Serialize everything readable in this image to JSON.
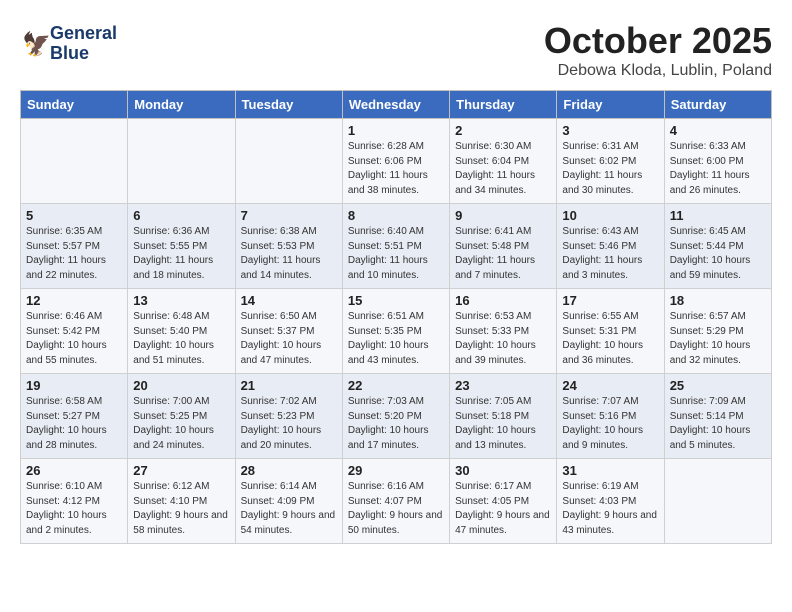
{
  "logo": {
    "line1": "General",
    "line2": "Blue"
  },
  "header": {
    "month_year": "October 2025",
    "location": "Debowa Kloda, Lublin, Poland"
  },
  "weekdays": [
    "Sunday",
    "Monday",
    "Tuesday",
    "Wednesday",
    "Thursday",
    "Friday",
    "Saturday"
  ],
  "weeks": [
    [
      {
        "day": "",
        "sunrise": "",
        "sunset": "",
        "daylight": ""
      },
      {
        "day": "",
        "sunrise": "",
        "sunset": "",
        "daylight": ""
      },
      {
        "day": "",
        "sunrise": "",
        "sunset": "",
        "daylight": ""
      },
      {
        "day": "1",
        "sunrise": "Sunrise: 6:28 AM",
        "sunset": "Sunset: 6:06 PM",
        "daylight": "Daylight: 11 hours and 38 minutes."
      },
      {
        "day": "2",
        "sunrise": "Sunrise: 6:30 AM",
        "sunset": "Sunset: 6:04 PM",
        "daylight": "Daylight: 11 hours and 34 minutes."
      },
      {
        "day": "3",
        "sunrise": "Sunrise: 6:31 AM",
        "sunset": "Sunset: 6:02 PM",
        "daylight": "Daylight: 11 hours and 30 minutes."
      },
      {
        "day": "4",
        "sunrise": "Sunrise: 6:33 AM",
        "sunset": "Sunset: 6:00 PM",
        "daylight": "Daylight: 11 hours and 26 minutes."
      }
    ],
    [
      {
        "day": "5",
        "sunrise": "Sunrise: 6:35 AM",
        "sunset": "Sunset: 5:57 PM",
        "daylight": "Daylight: 11 hours and 22 minutes."
      },
      {
        "day": "6",
        "sunrise": "Sunrise: 6:36 AM",
        "sunset": "Sunset: 5:55 PM",
        "daylight": "Daylight: 11 hours and 18 minutes."
      },
      {
        "day": "7",
        "sunrise": "Sunrise: 6:38 AM",
        "sunset": "Sunset: 5:53 PM",
        "daylight": "Daylight: 11 hours and 14 minutes."
      },
      {
        "day": "8",
        "sunrise": "Sunrise: 6:40 AM",
        "sunset": "Sunset: 5:51 PM",
        "daylight": "Daylight: 11 hours and 10 minutes."
      },
      {
        "day": "9",
        "sunrise": "Sunrise: 6:41 AM",
        "sunset": "Sunset: 5:48 PM",
        "daylight": "Daylight: 11 hours and 7 minutes."
      },
      {
        "day": "10",
        "sunrise": "Sunrise: 6:43 AM",
        "sunset": "Sunset: 5:46 PM",
        "daylight": "Daylight: 11 hours and 3 minutes."
      },
      {
        "day": "11",
        "sunrise": "Sunrise: 6:45 AM",
        "sunset": "Sunset: 5:44 PM",
        "daylight": "Daylight: 10 hours and 59 minutes."
      }
    ],
    [
      {
        "day": "12",
        "sunrise": "Sunrise: 6:46 AM",
        "sunset": "Sunset: 5:42 PM",
        "daylight": "Daylight: 10 hours and 55 minutes."
      },
      {
        "day": "13",
        "sunrise": "Sunrise: 6:48 AM",
        "sunset": "Sunset: 5:40 PM",
        "daylight": "Daylight: 10 hours and 51 minutes."
      },
      {
        "day": "14",
        "sunrise": "Sunrise: 6:50 AM",
        "sunset": "Sunset: 5:37 PM",
        "daylight": "Daylight: 10 hours and 47 minutes."
      },
      {
        "day": "15",
        "sunrise": "Sunrise: 6:51 AM",
        "sunset": "Sunset: 5:35 PM",
        "daylight": "Daylight: 10 hours and 43 minutes."
      },
      {
        "day": "16",
        "sunrise": "Sunrise: 6:53 AM",
        "sunset": "Sunset: 5:33 PM",
        "daylight": "Daylight: 10 hours and 39 minutes."
      },
      {
        "day": "17",
        "sunrise": "Sunrise: 6:55 AM",
        "sunset": "Sunset: 5:31 PM",
        "daylight": "Daylight: 10 hours and 36 minutes."
      },
      {
        "day": "18",
        "sunrise": "Sunrise: 6:57 AM",
        "sunset": "Sunset: 5:29 PM",
        "daylight": "Daylight: 10 hours and 32 minutes."
      }
    ],
    [
      {
        "day": "19",
        "sunrise": "Sunrise: 6:58 AM",
        "sunset": "Sunset: 5:27 PM",
        "daylight": "Daylight: 10 hours and 28 minutes."
      },
      {
        "day": "20",
        "sunrise": "Sunrise: 7:00 AM",
        "sunset": "Sunset: 5:25 PM",
        "daylight": "Daylight: 10 hours and 24 minutes."
      },
      {
        "day": "21",
        "sunrise": "Sunrise: 7:02 AM",
        "sunset": "Sunset: 5:23 PM",
        "daylight": "Daylight: 10 hours and 20 minutes."
      },
      {
        "day": "22",
        "sunrise": "Sunrise: 7:03 AM",
        "sunset": "Sunset: 5:20 PM",
        "daylight": "Daylight: 10 hours and 17 minutes."
      },
      {
        "day": "23",
        "sunrise": "Sunrise: 7:05 AM",
        "sunset": "Sunset: 5:18 PM",
        "daylight": "Daylight: 10 hours and 13 minutes."
      },
      {
        "day": "24",
        "sunrise": "Sunrise: 7:07 AM",
        "sunset": "Sunset: 5:16 PM",
        "daylight": "Daylight: 10 hours and 9 minutes."
      },
      {
        "day": "25",
        "sunrise": "Sunrise: 7:09 AM",
        "sunset": "Sunset: 5:14 PM",
        "daylight": "Daylight: 10 hours and 5 minutes."
      }
    ],
    [
      {
        "day": "26",
        "sunrise": "Sunrise: 6:10 AM",
        "sunset": "Sunset: 4:12 PM",
        "daylight": "Daylight: 10 hours and 2 minutes."
      },
      {
        "day": "27",
        "sunrise": "Sunrise: 6:12 AM",
        "sunset": "Sunset: 4:10 PM",
        "daylight": "Daylight: 9 hours and 58 minutes."
      },
      {
        "day": "28",
        "sunrise": "Sunrise: 6:14 AM",
        "sunset": "Sunset: 4:09 PM",
        "daylight": "Daylight: 9 hours and 54 minutes."
      },
      {
        "day": "29",
        "sunrise": "Sunrise: 6:16 AM",
        "sunset": "Sunset: 4:07 PM",
        "daylight": "Daylight: 9 hours and 50 minutes."
      },
      {
        "day": "30",
        "sunrise": "Sunrise: 6:17 AM",
        "sunset": "Sunset: 4:05 PM",
        "daylight": "Daylight: 9 hours and 47 minutes."
      },
      {
        "day": "31",
        "sunrise": "Sunrise: 6:19 AM",
        "sunset": "Sunset: 4:03 PM",
        "daylight": "Daylight: 9 hours and 43 minutes."
      },
      {
        "day": "",
        "sunrise": "",
        "sunset": "",
        "daylight": ""
      }
    ]
  ]
}
